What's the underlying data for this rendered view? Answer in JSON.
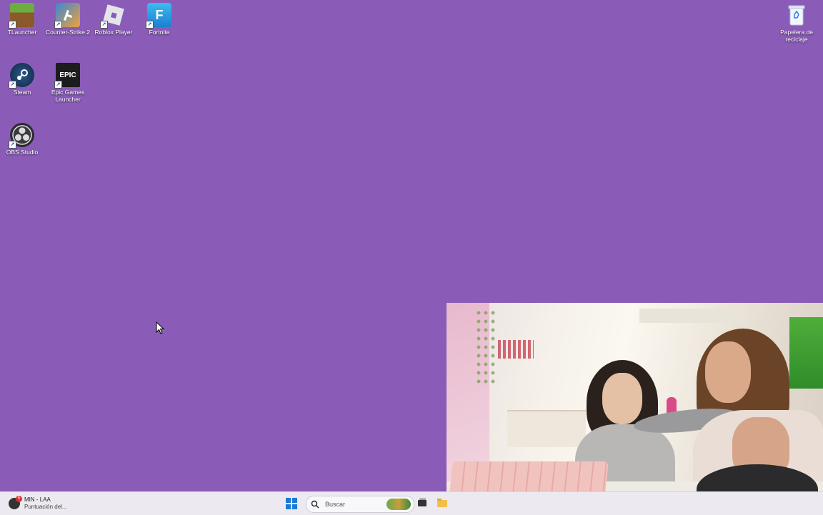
{
  "desktop": {
    "icons": [
      {
        "label": "TLauncher",
        "icon": "minecraft-grass-icon",
        "color": "#5b8c34"
      },
      {
        "label": "Counter-Strike 2",
        "icon": "counter-strike-icon",
        "color": "#2b6fb3"
      },
      {
        "label": "Roblox Player",
        "icon": "roblox-icon",
        "color": "#e8e8ee"
      },
      {
        "label": "Fortnite",
        "icon": "fortnite-icon",
        "color": "#29a8e8"
      },
      {
        "label": "Steam",
        "icon": "steam-icon",
        "color": "#1b3a5c"
      },
      {
        "label": "Epic Games Launcher",
        "icon": "epic-games-icon",
        "color": "#1c1c1c"
      },
      {
        "label": "OBS Studio",
        "icon": "obs-icon",
        "color": "#302f36"
      },
      {
        "label": "Papelera de reciclaje",
        "icon": "recycle-bin-icon",
        "color": "#ffffff"
      }
    ],
    "fortnite_letter": "F",
    "epic_text": "EPIC"
  },
  "taskbar": {
    "weather_title": "MIN - LAA",
    "weather_sub": "Puntuación del...",
    "weather_badge": "5",
    "search_placeholder": "Buscar"
  },
  "colors": {
    "wallpaper": "#8a5cb8",
    "taskbar": "#ece9f0",
    "accent": "#1a78d6"
  }
}
